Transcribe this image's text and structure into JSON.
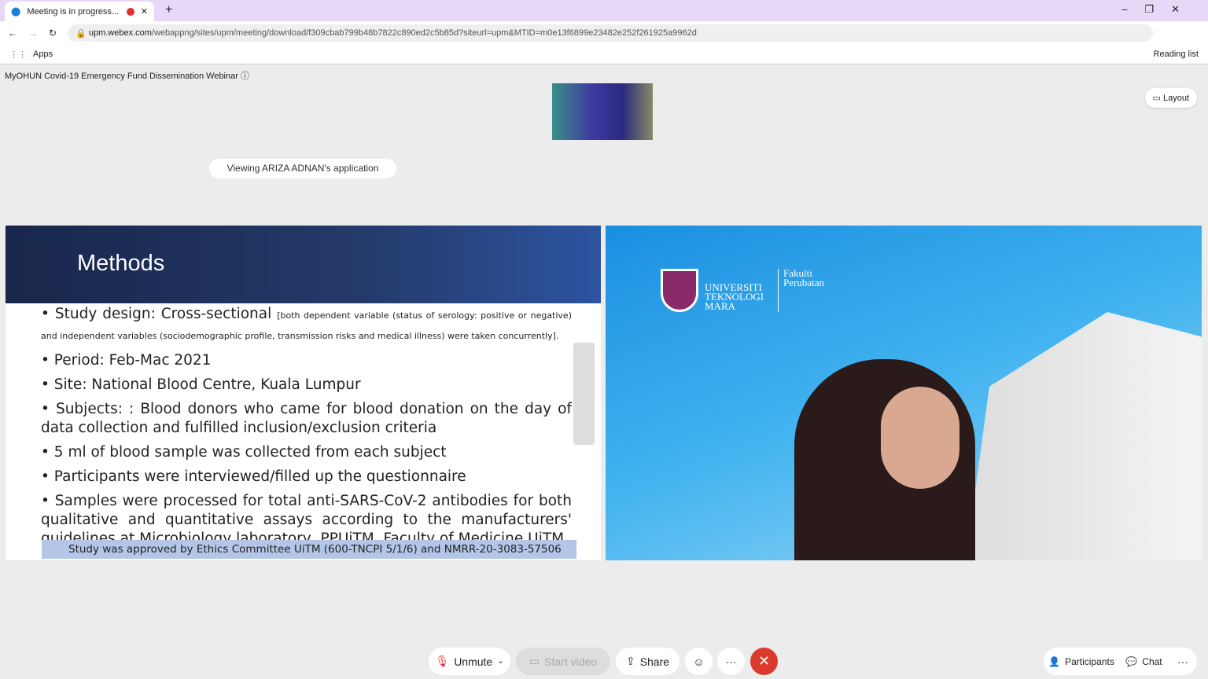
{
  "browser": {
    "tab_title": "Meeting is in progress...",
    "url_host": "upm.webex.com",
    "url_path": "/webappng/sites/upm/meeting/download/f309cbab799b48b7822c890ed2c5b85d?siteurl=upm&MTID=m0e13f6899e23482e252f261925a9962d",
    "apps": "Apps",
    "reading_list": "Reading list"
  },
  "meeting": {
    "title": "MyOHUN Covid-19 Emergency Fund Dissemination Webinar",
    "layout": "Layout",
    "viewing": "Viewing ARIZA ADNAN's application"
  },
  "slide": {
    "heading": "Methods",
    "bullets": [
      {
        "main": "Study design: Cross-sectional",
        "note": "[both dependent variable (status of serology: positive or negative) and independent variables (sociodemographic profile, transmission risks and medical illness) were taken concurrently]."
      },
      {
        "main": "Period: Feb-Mac 2021"
      },
      {
        "main": "Site: National Blood Centre, Kuala Lumpur"
      },
      {
        "main": "Subjects: : Blood donors who came for blood donation on the day of data collection and fulfilled inclusion/exclusion criteria"
      },
      {
        "main": "5 ml of blood sample was collected from each subject"
      },
      {
        "main": "Participants were interviewed/filled up the questionnaire"
      },
      {
        "main": "Samples were processed for total anti-SARS-CoV-2 antibodies for both qualitative and quantitative assays according to the manufacturers' guidelines at Microbiology laboratory, PPUiTM, Faculty of Medicine UiTM"
      }
    ],
    "ethics": "Study was approved by Ethics Committee UiTM (600-TNCPI 5/1/6) and NMRR-20-3083-57506"
  },
  "video": {
    "logo_uni": "UNIVERSITI TEKNOLOGI MARA",
    "logo_faculty": "Fakulti Perubatan"
  },
  "controls": {
    "unmute": "Unmute",
    "start_video": "Start video",
    "share": "Share",
    "more": "···",
    "end": "✕",
    "participants": "Participants",
    "chat": "Chat"
  }
}
